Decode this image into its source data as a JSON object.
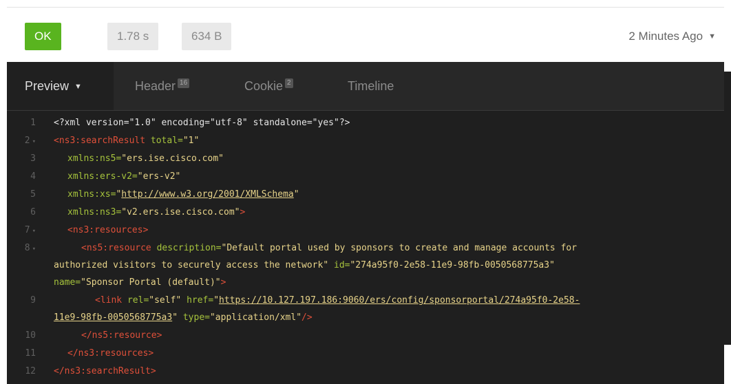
{
  "response": {
    "status_code": "200",
    "status_text": "OK",
    "time": "1.78 s",
    "size": "634 B",
    "received": "2 Minutes Ago"
  },
  "tabs": [
    {
      "label": "Preview"
    },
    {
      "label": "Header",
      "count": "16"
    },
    {
      "label": "Cookie",
      "count": "2"
    },
    {
      "label": "Timeline"
    }
  ],
  "xml": {
    "decl": "<?xml version=\"1.0\" encoding=\"utf-8\" standalone=\"yes\"?>",
    "root_open": "<ns3:searchResult",
    "total_attr": "total=",
    "total_val": "\"1\"",
    "ns5_attr": "xmlns:ns5=",
    "ns5_val": "\"ers.ise.cisco.com\"",
    "ersv2_attr": "xmlns:ers-v2=",
    "ersv2_val": "\"ers-v2\"",
    "xs_attr": "xmlns:xs=",
    "xs_q1": "\"",
    "xs_url": "http://www.w3.org/2001/XMLSchema",
    "xs_q2": "\"",
    "ns3_attr": "xmlns:ns3=",
    "ns3_val": "\"v2.ers.ise.cisco.com\"",
    "gt": ">",
    "resources_open": "<ns3:resources>",
    "resource_open": "<ns5:resource",
    "desc_attr": "description=",
    "desc_val1": "\"Default portal used by sponsors to create and manage accounts for",
    "desc_val2": "authorized visitors to securely access the network\"",
    "id_attr": "id=",
    "id_val": "\"274a95f0-2e58-11e9-98fb-0050568775a3\"",
    "name_attr": "name=",
    "name_val": "\"Sponsor Portal (default)\"",
    "link_open": "<link",
    "rel_attr": "rel=",
    "rel_val": "\"self\"",
    "href_attr": "href=",
    "href_q": "\"",
    "href_url1": "https://10.127.197.186:9060/ers/config/sponsorportal/274a95f0-2e58-",
    "href_url2": "11e9-98fb-0050568775a3",
    "type_attr": "type=",
    "type_val": "\"application/xml\"",
    "self_close": "/>",
    "resource_close": "</ns5:resource>",
    "resources_close": "</ns3:resources>",
    "root_close": "</ns3:searchResult>"
  },
  "line_numbers": [
    "1",
    "2",
    "3",
    "4",
    "5",
    "6",
    "7",
    "8",
    "9",
    "10",
    "11",
    "12"
  ],
  "colors": {
    "status_ok": "#59b41f",
    "editor_bg": "#1f1f1f",
    "tag": "#e0503a",
    "attribute": "#a6c33c",
    "string": "#e8d48a"
  }
}
